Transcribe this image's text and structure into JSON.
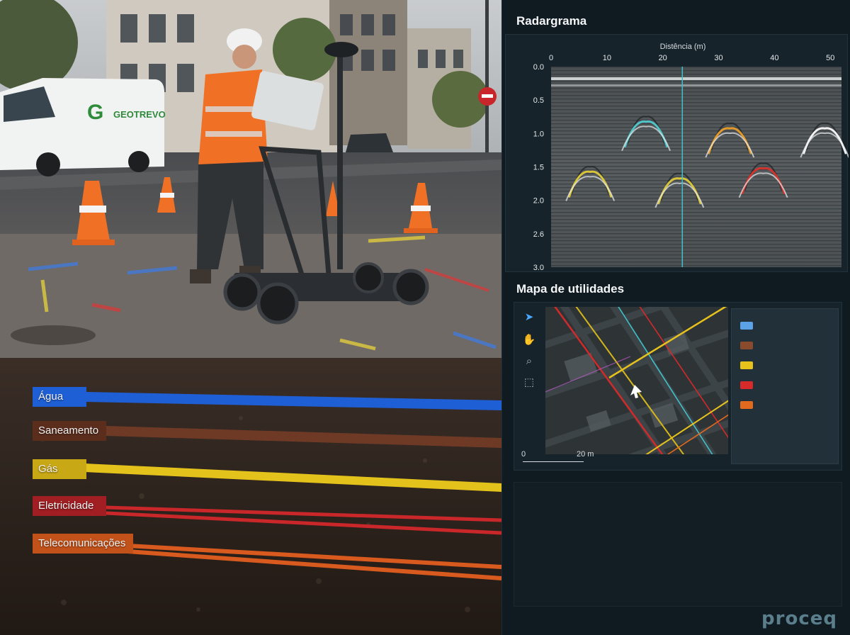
{
  "scene": {
    "van_brand": "GEOTREVO",
    "utilities": [
      {
        "label": "Água",
        "color": "#1f5fd6"
      },
      {
        "label": "Saneamento",
        "color": "#7a3b24"
      },
      {
        "label": "Gás",
        "color": "#e3c21c"
      },
      {
        "label": "Eletricidade",
        "color": "#d12a2a"
      },
      {
        "label": "Telecomunicações",
        "color": "#e0621e"
      }
    ]
  },
  "radar": {
    "title": "Radargrama",
    "x_axis_label": "Distência (m)",
    "x_ticks": [
      "0",
      "10",
      "20",
      "30",
      "40",
      "50"
    ],
    "y_ticks": [
      "0.0",
      "0.5",
      "1.0",
      "1.5",
      "2.0",
      "2.6",
      "3.0"
    ]
  },
  "map": {
    "title": "Mapa de utilidades",
    "tools": [
      "select-arrow-icon",
      "hand-pan-icon",
      "zoom-icon",
      "zoom-area-icon"
    ],
    "scale_start": "0",
    "scale_end": "20 m",
    "legend_colors": [
      "#5ba3e6",
      "#8a4a2c",
      "#e7c21d",
      "#d72a2a",
      "#e26a1e"
    ]
  },
  "brand": "proceq",
  "chart_data": {
    "type": "scatter",
    "title": "Radargrama",
    "xlabel": "Distência (m)",
    "ylabel": "",
    "xlim": [
      0,
      52
    ],
    "ylim": [
      3.0,
      0.0
    ],
    "series": [
      {
        "values": [
          {
            "x": 7,
            "y": 1.5,
            "color": "#d8c43a"
          },
          {
            "x": 23,
            "y": 1.6,
            "color": "#d8c43a"
          }
        ]
      },
      {
        "values": [
          {
            "x": 17,
            "y": 0.75,
            "color": "#4fc3c6"
          }
        ]
      },
      {
        "values": [
          {
            "x": 32,
            "y": 0.85,
            "color": "#e39a2b"
          }
        ]
      },
      {
        "values": [
          {
            "x": 38,
            "y": 1.45,
            "color": "#d0342c"
          }
        ]
      },
      {
        "values": [
          {
            "x": 49,
            "y": 0.85,
            "color": "#f2f2f2"
          }
        ]
      }
    ],
    "cursor_x": 23.5
  }
}
